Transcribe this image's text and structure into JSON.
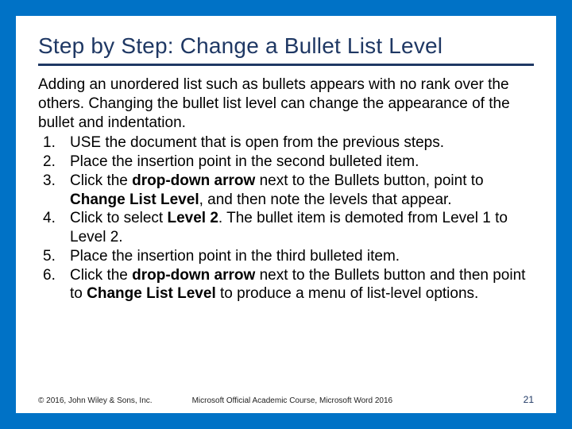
{
  "title": "Step by Step: Change a Bullet List Level",
  "intro": "Adding an unordered list such as bullets appears with no rank over the others. Changing the bullet list level can change the appearance of the bullet and indentation.",
  "steps": [
    {
      "segments": [
        {
          "t": "USE the document that is open from the previous steps."
        }
      ]
    },
    {
      "segments": [
        {
          "t": "Place the insertion point in the second bulleted item."
        }
      ]
    },
    {
      "segments": [
        {
          "t": "Click the "
        },
        {
          "t": "drop-down arrow",
          "b": true
        },
        {
          "t": " next to the Bullets button, point to "
        },
        {
          "t": "Change List Level",
          "b": true
        },
        {
          "t": ", and then note the levels that appear."
        }
      ]
    },
    {
      "segments": [
        {
          "t": "Click to select "
        },
        {
          "t": "Level 2",
          "b": true
        },
        {
          "t": ". The bullet item is demoted from Level 1 to Level 2."
        }
      ]
    },
    {
      "segments": [
        {
          "t": "Place the insertion point in the third bulleted item."
        }
      ]
    },
    {
      "segments": [
        {
          "t": "Click the "
        },
        {
          "t": "drop-down arrow",
          "b": true
        },
        {
          "t": " next to the Bullets button and then point to "
        },
        {
          "t": "Change List Level",
          "b": true
        },
        {
          "t": " to produce a menu of list-level options."
        }
      ]
    }
  ],
  "footer": {
    "copyright": "© 2016, John Wiley & Sons, Inc.",
    "center": "Microsoft Official Academic Course, Microsoft Word 2016",
    "page": "21"
  }
}
